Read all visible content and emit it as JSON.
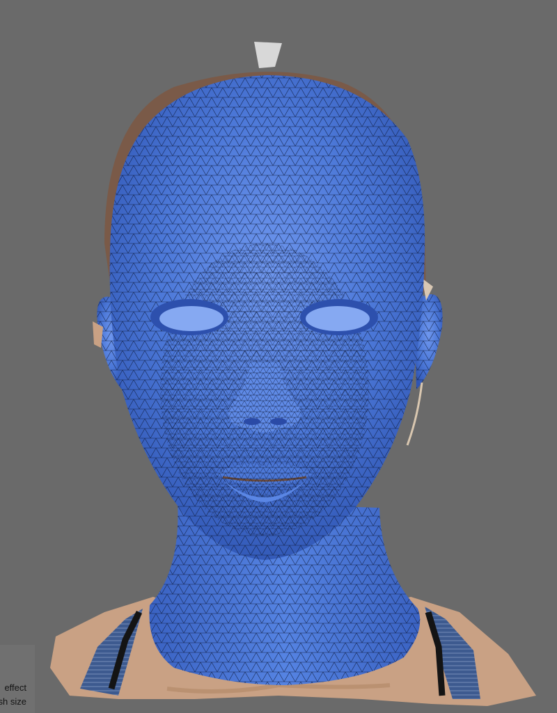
{
  "viewport": {
    "background_color": "#6a6a6a",
    "model": {
      "mesh_color": "#4a78d8",
      "wire_color": "#0e1a3a",
      "scan_skin_color": "#c9a184",
      "scan_fabric_color": "#3d5a8f"
    }
  },
  "hud": {
    "effect_label": "effect",
    "brush_size_label": "sh size"
  }
}
